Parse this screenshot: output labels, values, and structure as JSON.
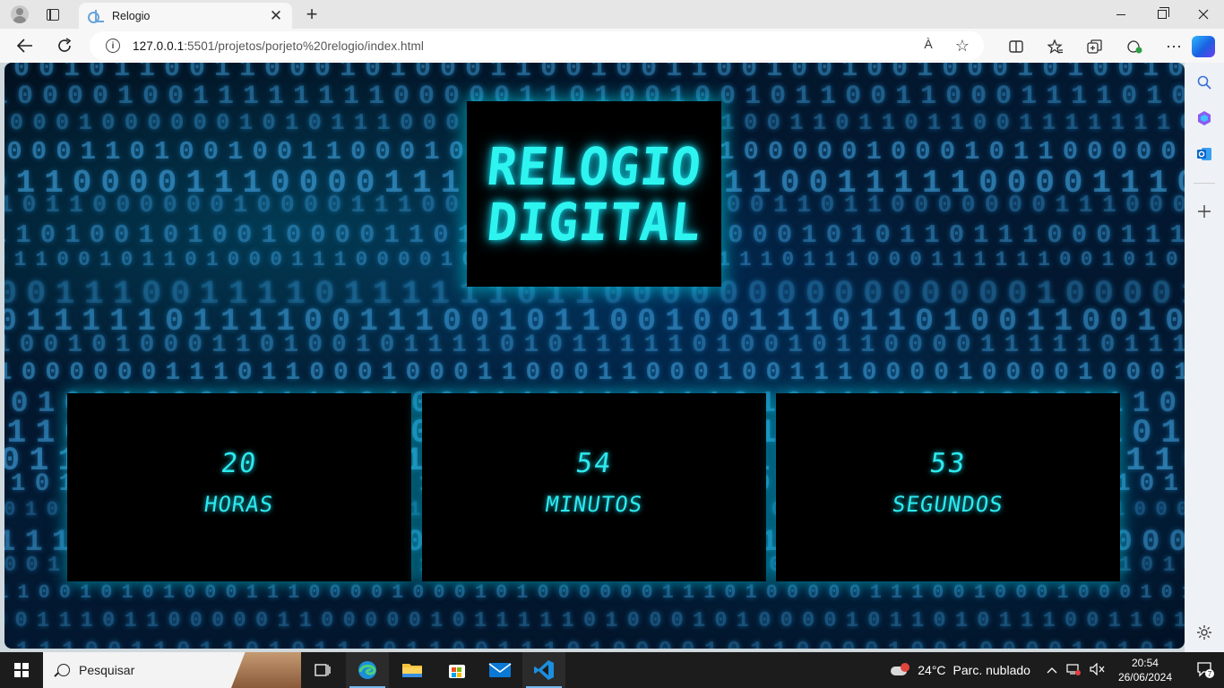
{
  "browser": {
    "tab_title": "Relogio",
    "close_tab_glyph": "✕",
    "new_tab_glyph": "+",
    "url_host": "127.0.0.1",
    "url_rest": ":5501/projetos/porjeto%20relogio/index.html",
    "info_glyph": "i",
    "read_aloud_glyph": "À",
    "favorite_glyph": "☆",
    "more_glyph": "⋯"
  },
  "page": {
    "title_line1": "RELOGIO",
    "title_line2": "DIGITAL",
    "hours": {
      "value": "20",
      "label": "HORAS"
    },
    "minutes": {
      "value": "54",
      "label": "MINUTOS"
    },
    "seconds": {
      "value": "53",
      "label": "SEGUNDOS"
    }
  },
  "taskbar": {
    "search_placeholder": "Pesquisar",
    "temperature": "24°C",
    "weather_text": "Parc. nublado",
    "time": "20:54",
    "date": "26/06/2024",
    "notifications_count": "7"
  },
  "colors": {
    "accent_cyan": "#2ef4f0",
    "background_dark": "#031a33"
  },
  "icons": [
    "profile-icon",
    "tab-actions-icon",
    "favicon-icon",
    "back-icon",
    "refresh-icon",
    "info-icon",
    "read-aloud-icon",
    "favorite-star-icon",
    "split-screen-icon",
    "favorites-icon",
    "collections-icon",
    "browser-essentials-icon",
    "more-icon",
    "copilot-icon",
    "sidebar-search-icon",
    "sidebar-copilot-icon",
    "sidebar-outlook-icon",
    "sidebar-add-icon",
    "sidebar-settings-icon",
    "windows-start-icon",
    "task-view-icon",
    "edge-icon",
    "file-explorer-icon",
    "store-icon",
    "mail-icon",
    "vscode-icon"
  ]
}
